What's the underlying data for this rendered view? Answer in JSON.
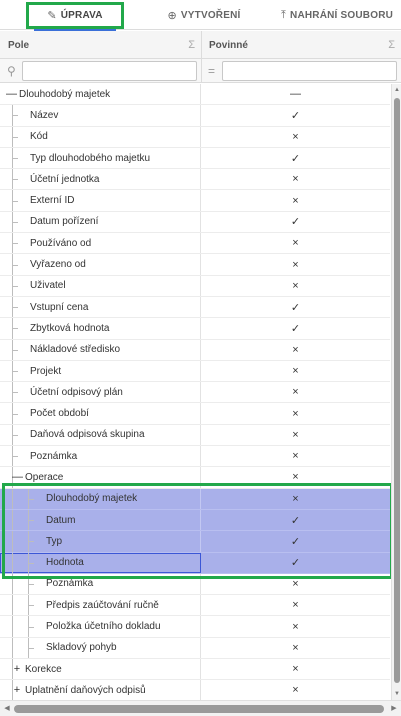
{
  "tabs": [
    {
      "label": "ÚPRAVA",
      "icon": "pencil-icon",
      "active": true
    },
    {
      "label": "VYTVOŘENÍ",
      "icon": "plus-circle-icon",
      "active": false
    },
    {
      "label": "NAHRÁNÍ SOUBORU",
      "icon": "upload-icon",
      "active": false
    }
  ],
  "columns": {
    "pole": "Pole",
    "povinne": "Povinné",
    "sigma": "Σ"
  },
  "filters": {
    "search_icon": "search-icon",
    "equals_icon": "equals-icon",
    "pole_value": "",
    "povinne_value": ""
  },
  "symbols": {
    "yes": "✓",
    "no": "×",
    "dash": "—"
  },
  "rows": [
    {
      "label": "Dlouhodobý majetek",
      "level": 0,
      "toggle": "—",
      "value": "—",
      "selected": false
    },
    {
      "label": "Název",
      "level": 1,
      "toggle": "",
      "value": "✓",
      "selected": false
    },
    {
      "label": "Kód",
      "level": 1,
      "toggle": "",
      "value": "×",
      "selected": false
    },
    {
      "label": "Typ dlouhodobého majetku",
      "level": 1,
      "toggle": "",
      "value": "✓",
      "selected": false
    },
    {
      "label": "Účetní jednotka",
      "level": 1,
      "toggle": "",
      "value": "×",
      "selected": false
    },
    {
      "label": "Externí ID",
      "level": 1,
      "toggle": "",
      "value": "×",
      "selected": false
    },
    {
      "label": "Datum pořízení",
      "level": 1,
      "toggle": "",
      "value": "✓",
      "selected": false
    },
    {
      "label": "Používáno od",
      "level": 1,
      "toggle": "",
      "value": "×",
      "selected": false
    },
    {
      "label": "Vyřazeno od",
      "level": 1,
      "toggle": "",
      "value": "×",
      "selected": false
    },
    {
      "label": "Uživatel",
      "level": 1,
      "toggle": "",
      "value": "×",
      "selected": false
    },
    {
      "label": "Vstupní cena",
      "level": 1,
      "toggle": "",
      "value": "✓",
      "selected": false
    },
    {
      "label": "Zbytková hodnota",
      "level": 1,
      "toggle": "",
      "value": "✓",
      "selected": false
    },
    {
      "label": "Nákladové středisko",
      "level": 1,
      "toggle": "",
      "value": "×",
      "selected": false
    },
    {
      "label": "Projekt",
      "level": 1,
      "toggle": "",
      "value": "×",
      "selected": false
    },
    {
      "label": "Účetní odpisový plán",
      "level": 1,
      "toggle": "",
      "value": "×",
      "selected": false
    },
    {
      "label": "Počet období",
      "level": 1,
      "toggle": "",
      "value": "×",
      "selected": false
    },
    {
      "label": "Daňová odpisová skupina",
      "level": 1,
      "toggle": "",
      "value": "×",
      "selected": false
    },
    {
      "label": "Poznámka",
      "level": 1,
      "toggle": "",
      "value": "×",
      "selected": false
    },
    {
      "label": "Operace",
      "level": 1,
      "toggle": "—",
      "value": "×",
      "selected": false
    },
    {
      "label": "Dlouhodobý majetek",
      "level": 2,
      "toggle": "",
      "value": "×",
      "selected": true
    },
    {
      "label": "Datum",
      "level": 2,
      "toggle": "",
      "value": "✓",
      "selected": true
    },
    {
      "label": "Typ",
      "level": 2,
      "toggle": "",
      "value": "✓",
      "selected": true
    },
    {
      "label": "Hodnota",
      "level": 2,
      "toggle": "",
      "value": "✓",
      "selected": true,
      "focused": true
    },
    {
      "label": "Poznámka",
      "level": 2,
      "toggle": "",
      "value": "×",
      "selected": false
    },
    {
      "label": "Předpis zaúčtování ručně",
      "level": 2,
      "toggle": "",
      "value": "×",
      "selected": false
    },
    {
      "label": "Položka účetního dokladu",
      "level": 2,
      "toggle": "",
      "value": "×",
      "selected": false
    },
    {
      "label": "Skladový pohyb",
      "level": 2,
      "toggle": "",
      "value": "×",
      "selected": false
    },
    {
      "label": "Korekce",
      "level": 1,
      "toggle": "+",
      "value": "×",
      "selected": false
    },
    {
      "label": "Uplatnění daňových odpisů",
      "level": 1,
      "toggle": "+",
      "value": "×",
      "selected": false
    }
  ],
  "colors": {
    "selection": "#a9b0ea",
    "highlight_border": "#22a84a",
    "active_tab_underline": "#3a6fd8"
  }
}
